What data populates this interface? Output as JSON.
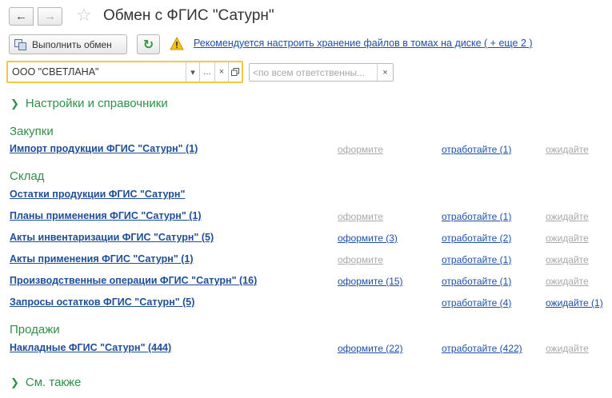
{
  "window": {
    "title": "Обмен с ФГИС \"Сатурн\""
  },
  "toolbar": {
    "exchange_label": "Выполнить обмен",
    "warning_text": "Рекомендуется настроить хранение файлов в томах на диске ( + еще 2 )"
  },
  "filters": {
    "organization": "ООО \"СВЕТЛАНА\"",
    "responsible_placeholder": "<по всем ответственны...",
    "dropdown_glyph": "▾",
    "select_glyph": "...",
    "clear_glyph": "×"
  },
  "groups": {
    "settings": "Настройки и справочники",
    "see_also": "См. также"
  },
  "sections": [
    {
      "title": "Закупки",
      "rows": [
        {
          "label": "Импорт продукции ФГИС \"Сатурн\" (1)",
          "c1": "оформите",
          "c1_active": false,
          "c2": "отработайте (1)",
          "c2_active": true,
          "c3": "ожидайте",
          "c3_active": false
        }
      ]
    },
    {
      "title": "Склад",
      "rows": [
        {
          "label": "Остатки продукции ФГИС \"Сатурн\"",
          "c1": "",
          "c1_active": false,
          "c2": "",
          "c2_active": false,
          "c3": "",
          "c3_active": false
        },
        {
          "label": "Планы применения ФГИС \"Сатурн\" (1)",
          "c1": "оформите",
          "c1_active": false,
          "c2": "отработайте (1)",
          "c2_active": true,
          "c3": "ожидайте",
          "c3_active": false
        },
        {
          "label": "Акты инвентаризации ФГИС \"Сатурн\" (5)",
          "c1": "оформите (3)",
          "c1_active": true,
          "c2": "отработайте (2)",
          "c2_active": true,
          "c3": "ожидайте",
          "c3_active": false
        },
        {
          "label": "Акты применения ФГИС \"Сатурн\" (1)",
          "c1": "оформите",
          "c1_active": false,
          "c2": "отработайте (1)",
          "c2_active": true,
          "c3": "ожидайте",
          "c3_active": false
        },
        {
          "label": "Производственные операции ФГИС \"Сатурн\" (16)",
          "c1": "оформите (15)",
          "c1_active": true,
          "c2": "отработайте (1)",
          "c2_active": true,
          "c3": "ожидайте",
          "c3_active": false
        },
        {
          "label": "Запросы остатков ФГИС \"Сатурн\" (5)",
          "c1": "",
          "c1_active": false,
          "c2": "отработайте (4)",
          "c2_active": true,
          "c3": "ожидайте (1)",
          "c3_active": true
        }
      ]
    },
    {
      "title": "Продажи",
      "rows": [
        {
          "label": "Накладные ФГИС \"Сатурн\" (444)",
          "c1": "оформите (22)",
          "c1_active": true,
          "c2": "отработайте (422)",
          "c2_active": true,
          "c3": "ожидайте",
          "c3_active": false
        }
      ]
    }
  ],
  "colors": {
    "section": "#2f8f48",
    "link": "#1f4e96",
    "inactive": "#a9a9a9",
    "highlight_border": "#f5c642"
  }
}
